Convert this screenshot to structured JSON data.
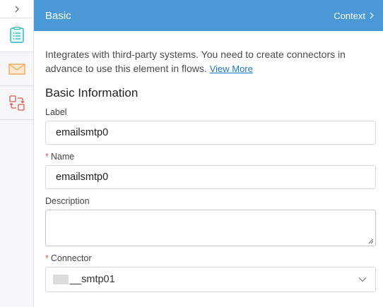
{
  "header": {
    "title": "Basic",
    "context_label": "Context"
  },
  "rail": {
    "items": [
      {
        "icon": "list-icon",
        "active": true
      },
      {
        "icon": "mail-icon",
        "active": false
      },
      {
        "icon": "connector-icon",
        "active": false
      }
    ]
  },
  "intro": {
    "text": "Integrates with third-party systems. You need to create connectors in advance to use this element in flows.",
    "link": "View More"
  },
  "section": {
    "title": "Basic Information"
  },
  "fields": {
    "label": {
      "label": "Label",
      "value": "emailsmtp0"
    },
    "name": {
      "label": "Name",
      "required_mark": "*",
      "value": "emailsmtp0"
    },
    "description": {
      "label": "Description",
      "value": ""
    },
    "connector": {
      "label": "Connector",
      "required_mark": "*",
      "value": "__smtp01"
    }
  },
  "colors": {
    "header_bg": "#4a99d6",
    "link": "#1a76c8",
    "required": "#e34d4d",
    "rail_icon_active": "#2bb3b8",
    "rail_icon_mail": "#e8a550",
    "rail_icon_connector": "#e0584f"
  }
}
